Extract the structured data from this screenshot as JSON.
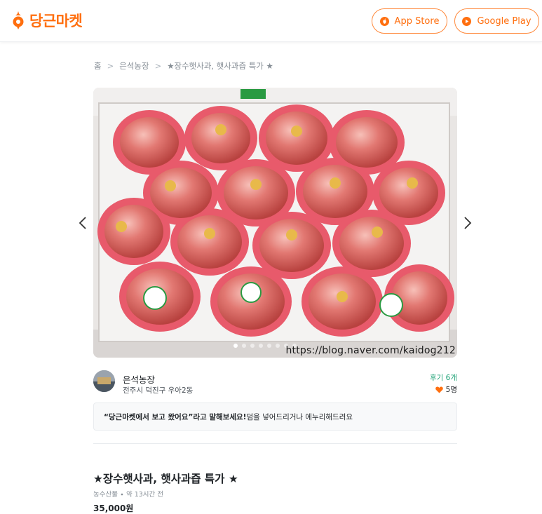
{
  "header": {
    "logo_text": "당근마켓",
    "app_store_label": "App Store",
    "google_play_label": "Google Play"
  },
  "breadcrumb": {
    "home": "홈",
    "category": "은석농장",
    "current": "★장수햇사과, 햇사과즙 특가 ★",
    "separator": ">"
  },
  "image": {
    "watermark": "https://blog.naver.com/kaidog212",
    "slide_count": 8,
    "active_slide": 1
  },
  "seller": {
    "name": "은석농장",
    "address": "전주시 덕진구 우아2동",
    "reviews": "후기 6개",
    "likes": "5명"
  },
  "notice": {
    "highlight": "“당근마켓에서 보고 왔어요”라고 말해보세요!",
    "rest": " 덤을 넣어드리거나 에누리해드려요"
  },
  "article": {
    "title": "★장수햇사과, 햇사과즙 특가 ★",
    "meta": "농수산물 ∙ 약 13시간 전",
    "price": "35,000원"
  },
  "colors": {
    "brand": "#ff6f0f",
    "review_green": "#1aa174"
  }
}
